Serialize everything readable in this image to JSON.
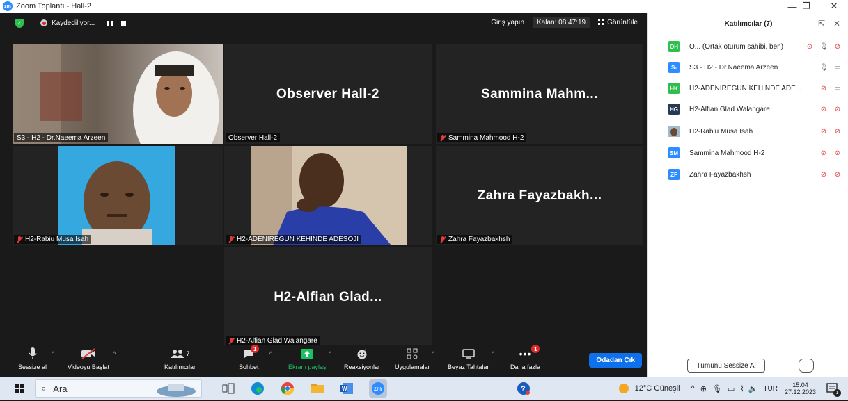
{
  "window": {
    "title": "Zoom Toplantı - Hall-2",
    "logo": "zm"
  },
  "topbar": {
    "recording": "Kaydediliyor...",
    "signin": "Giriş yapın",
    "remaining": "Kalan: 08:47:19",
    "view": "Görüntüle"
  },
  "tiles": [
    {
      "big": "",
      "label": "S3 - H2 - Dr.Naeema Arzeen",
      "muted": false
    },
    {
      "big": "Observer Hall-2",
      "label": "Observer Hall-2",
      "muted": false
    },
    {
      "big": "Sammina  Mahm...",
      "label": "Sammina Mahmood H-2",
      "muted": true
    },
    {
      "big": "",
      "label": "H2-Rabiu Musa Isah",
      "muted": true
    },
    {
      "big": "",
      "label": "H2-ADENIREGUN KEHINDE ADESOJI",
      "muted": true
    },
    {
      "big": "Zahra  Fayazbakh...",
      "label": "Zahra Fayazbakhsh",
      "muted": true
    },
    {
      "big": "H2-Alfian  Glad...",
      "label": "H2-Alfian Glad Walangare",
      "muted": true
    }
  ],
  "toolbar": {
    "mute": "Sessize al",
    "video": "Videoyu Başlat",
    "participants": "Katılımcılar",
    "participants_count": "7",
    "chat": "Sohbet",
    "chat_badge": "1",
    "share": "Ekranı paylaş",
    "reactions": "Reaksiyonlar",
    "apps": "Uygulamalar",
    "whiteboard": "Beyaz Tahtalar",
    "more": "Daha fazla",
    "more_badge": "1",
    "leave": "Odadan Çık"
  },
  "panel": {
    "title": "Katılımcılar (7)",
    "participants": [
      {
        "initials": "OH",
        "color": "#2fbf4f",
        "name": "O... (Ortak oturum sahibi, ben)"
      },
      {
        "initials": "S-",
        "color": "#2d8cff",
        "name": "S3 - H2 - Dr.Naeema Arzeen"
      },
      {
        "initials": "HK",
        "color": "#2fbf4f",
        "name": "H2-ADENIREGUN KEHINDE ADE..."
      },
      {
        "initials": "HG",
        "color": "#263a55",
        "name": "H2-Alfian Glad Walangare"
      },
      {
        "initials": "",
        "color": "#9a8a78",
        "name": "H2-Rabiu Musa Isah"
      },
      {
        "initials": "SM",
        "color": "#2d8cff",
        "name": "Sammina Mahmood H-2"
      },
      {
        "initials": "ZF",
        "color": "#2d8cff",
        "name": "Zahra Fayazbakhsh"
      }
    ],
    "mute_all": "Tümünü Sessize Al",
    "more": "···"
  },
  "taskbar": {
    "search": "Ara",
    "weather": "12°C  Güneşli",
    "lang": "TUR",
    "time": "15:04",
    "date": "27.12.2023",
    "notification_count": "1"
  }
}
